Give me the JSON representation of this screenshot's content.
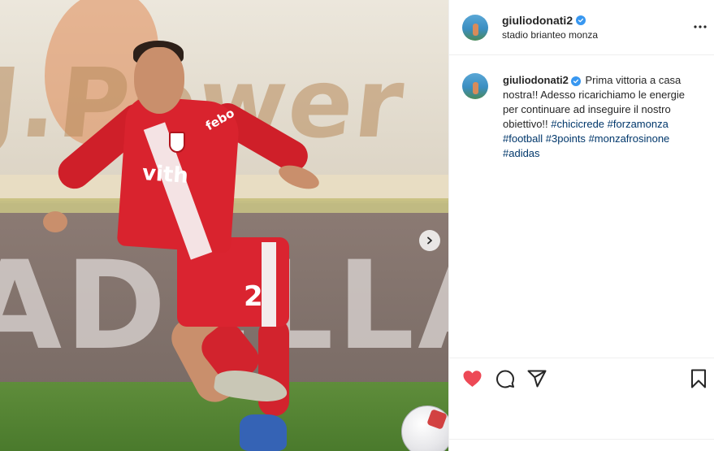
{
  "post": {
    "username": "giuliodonati2",
    "location": "stadio brianteo monza",
    "verified": true,
    "caption": {
      "username": "giuliodonati2",
      "text": "Prima vittoria a casa nostra!! Adesso ricarichiamo le energie per continuare ad inseguire il nostro obiettivo!!",
      "hashtags": [
        "#chicicrede",
        "#forzamonza",
        "#football",
        "#3points",
        "#monzafrosinone",
        "#adidas"
      ]
    },
    "photo": {
      "banner_text": "J.Power",
      "board_text": "ADELLA",
      "jersey_text": "vith",
      "jersey_sponsor": "febo",
      "shorts_number": "2"
    },
    "liked": true
  },
  "colors": {
    "like_red": "#ed4956",
    "link_blue": "#00376b",
    "verified_blue": "#3897f0",
    "border": "#efefef",
    "text": "#262626"
  },
  "icons": {
    "more": "more-options-icon",
    "next": "chevron-right-icon",
    "like": "heart-icon",
    "comment": "comment-icon",
    "share": "paper-plane-icon",
    "save": "bookmark-icon",
    "verified": "verified-badge-icon"
  }
}
